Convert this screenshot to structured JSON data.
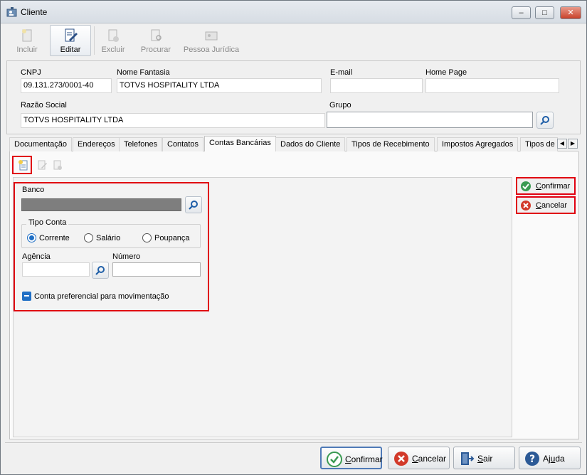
{
  "window": {
    "title": "Cliente"
  },
  "window_controls": {
    "minimize": "–",
    "maximize": "□",
    "close": "✕"
  },
  "toolbar": {
    "incluir": "Incluir",
    "editar": "Editar",
    "excluir": "Excluir",
    "procurar": "Procurar",
    "pessoa_juridica": "Pessoa Jurídica"
  },
  "header": {
    "cnpj_label": "CNPJ",
    "cnpj_value": "09.131.273/0001-40",
    "nome_fantasia_label": "Nome Fantasia",
    "nome_fantasia_value": "TOTVS HOSPITALITY LTDA",
    "email_label": "E-mail",
    "email_value": "",
    "home_page_label": "Home Page",
    "home_page_value": "",
    "razao_social_label": "Razão Social",
    "razao_social_value": "TOTVS HOSPITALITY LTDA",
    "grupo_label": "Grupo",
    "grupo_value": ""
  },
  "tabs": [
    {
      "label": "Documentação"
    },
    {
      "label": "Endereços"
    },
    {
      "label": "Telefones"
    },
    {
      "label": "Contatos"
    },
    {
      "label": "Contas Bancárias"
    },
    {
      "label": "Dados do Cliente"
    },
    {
      "label": "Tipos de Recebimento"
    },
    {
      "label": "Impostos Agregados"
    },
    {
      "label": "Tipos de"
    }
  ],
  "active_tab": "Contas Bancárias",
  "tab_scroll": {
    "left": "◀",
    "right": "▶"
  },
  "form": {
    "banco_label": "Banco",
    "tipo_conta_label": "Tipo Conta",
    "tipo_conta_options": [
      "Corrente",
      "Salário",
      "Poupança"
    ],
    "tipo_conta_selected": "Corrente",
    "agencia_label": "Agência",
    "agencia_value": "",
    "numero_label": "Número",
    "numero_value": "",
    "conta_preferencial_label": "Conta preferencial para movimentação"
  },
  "side_actions": {
    "confirmar": {
      "prefix": "C",
      "rest": "onfirmar"
    },
    "cancelar": {
      "prefix": "C",
      "rest": "ancelar"
    }
  },
  "footer": {
    "confirmar": {
      "prefix": "C",
      "rest": "onfirmar"
    },
    "cancelar": {
      "prefix": "C",
      "rest": "ancelar"
    },
    "sair": {
      "prefix": "S",
      "rest": "air"
    },
    "ajuda": {
      "prefix": "Aj",
      "u": "u",
      "rest": "da"
    }
  },
  "colors": {
    "highlight_red": "#e00010",
    "accent_blue": "#1f6fc5",
    "confirm_green": "#3a9a52",
    "cancel_red": "#d23a2a"
  },
  "icons": {
    "app": "client-card-icon",
    "incluir": "new-document-icon",
    "editar": "edit-pencil-icon",
    "excluir": "delete-document-icon",
    "procurar": "search-document-icon",
    "pessoa_juridica": "id-card-icon",
    "search": "magnifier-icon"
  }
}
